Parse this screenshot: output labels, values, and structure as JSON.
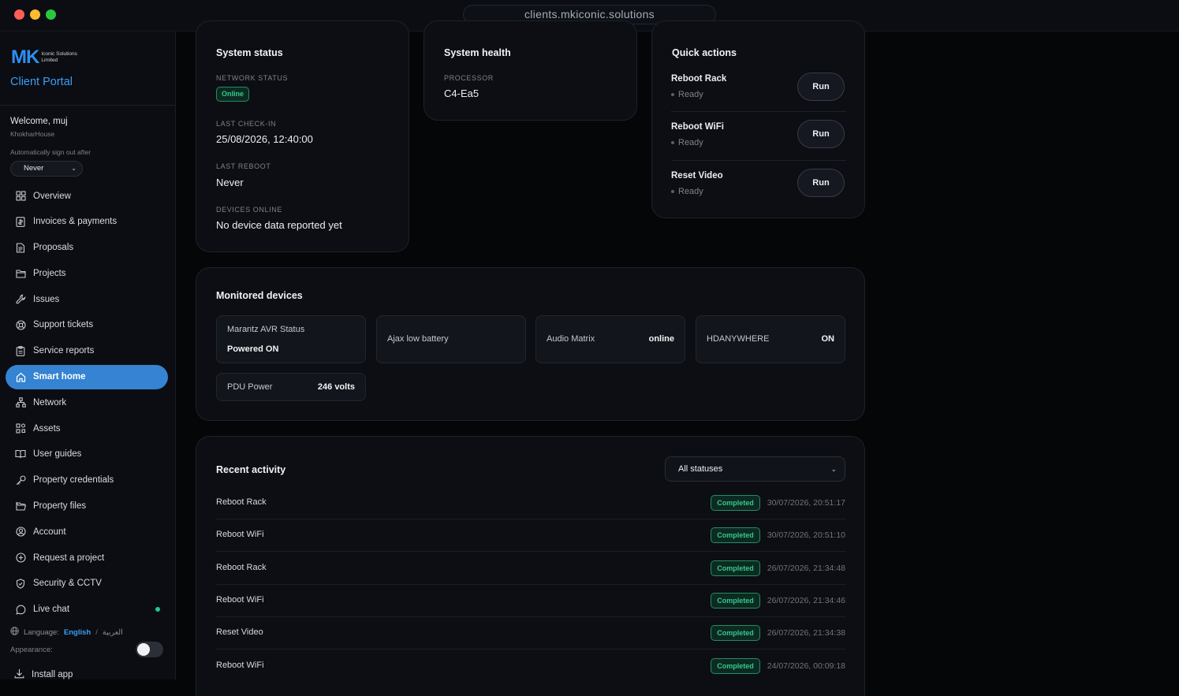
{
  "browser": {
    "url": "clients.mkiconic.solutions"
  },
  "sidebar": {
    "logo_mark": "MK",
    "logo_text": "Iconic Solutions Limited",
    "portal_title": "Client Portal",
    "welcome": "Welcome, muj",
    "property": "KhokharHouse",
    "autosign_label": "Automatically sign out after",
    "autosign_value": "Never",
    "items": [
      {
        "label": "Overview",
        "icon": "grid-icon"
      },
      {
        "label": "Invoices & payments",
        "icon": "invoice-icon"
      },
      {
        "label": "Proposals",
        "icon": "document-icon"
      },
      {
        "label": "Projects",
        "icon": "folder-icon"
      },
      {
        "label": "Issues",
        "icon": "wrench-icon"
      },
      {
        "label": "Support tickets",
        "icon": "lifebuoy-icon"
      },
      {
        "label": "Service reports",
        "icon": "clipboard-icon"
      },
      {
        "label": "Smart home",
        "icon": "home-icon",
        "active": true
      },
      {
        "label": "Network",
        "icon": "network-icon"
      },
      {
        "label": "Assets",
        "icon": "assets-icon"
      },
      {
        "label": "User guides",
        "icon": "book-icon"
      },
      {
        "label": "Property credentials",
        "icon": "key-icon"
      },
      {
        "label": "Property files",
        "icon": "folder-open-icon"
      },
      {
        "label": "Account",
        "icon": "user-circle-icon"
      },
      {
        "label": "Request a project",
        "icon": "plus-circle-icon"
      },
      {
        "label": "Security & CCTV",
        "icon": "shield-icon"
      },
      {
        "label": "Live chat",
        "icon": "chat-icon",
        "online_dot_color": "#21c98c"
      }
    ],
    "language_label": "Language:",
    "language_en": "English",
    "language_sep": "/",
    "language_ar": "العربية",
    "appearance_label": "Appearance:",
    "install_label": "Install app"
  },
  "system_status": {
    "title": "System status",
    "network_label": "NETWORK STATUS",
    "network_value": "Online",
    "checkin_label": "LAST CHECK-IN",
    "checkin_value": "25/08/2026, 12:40:00",
    "reboot_label": "LAST REBOOT",
    "reboot_value": "Never",
    "devices_label": "DEVICES ONLINE",
    "devices_value": "No device data reported yet"
  },
  "system_health": {
    "title": "System health",
    "processor_label": "PROCESSOR",
    "processor_value": "C4-Ea5"
  },
  "quick_actions": {
    "title": "Quick actions",
    "items": [
      {
        "name": "Reboot Rack",
        "status": "Ready",
        "button": "Run"
      },
      {
        "name": "Reboot WiFi",
        "status": "Ready",
        "button": "Run"
      },
      {
        "name": "Reset Video",
        "status": "Ready",
        "button": "Run"
      }
    ]
  },
  "monitored_devices": {
    "title": "Monitored devices",
    "devices": [
      {
        "name": "Marantz AVR Status",
        "value": "Powered ON"
      },
      {
        "name": "Ajax low battery",
        "value": ""
      },
      {
        "name": "Audio Matrix",
        "value": "online"
      },
      {
        "name": "HDANYWHERE",
        "value": "ON"
      },
      {
        "name": "PDU Power",
        "value": "246 volts"
      }
    ]
  },
  "recent_activity": {
    "title": "Recent activity",
    "filter_value": "All statuses",
    "rows": [
      {
        "name": "Reboot Rack",
        "status": "Completed",
        "time": "30/07/2026, 20:51:17"
      },
      {
        "name": "Reboot WiFi",
        "status": "Completed",
        "time": "30/07/2026, 20:51:10"
      },
      {
        "name": "Reboot Rack",
        "status": "Completed",
        "time": "26/07/2026, 21:34:48"
      },
      {
        "name": "Reboot WiFi",
        "status": "Completed",
        "time": "26/07/2026, 21:34:46"
      },
      {
        "name": "Reset Video",
        "status": "Completed",
        "time": "26/07/2026, 21:34:38"
      },
      {
        "name": "Reboot WiFi",
        "status": "Completed",
        "time": "24/07/2026, 00:09:18"
      }
    ]
  },
  "colors": {
    "accent": "#3583d2",
    "success": "#34c98e",
    "background": "#050608",
    "card": "#0c0e13"
  }
}
